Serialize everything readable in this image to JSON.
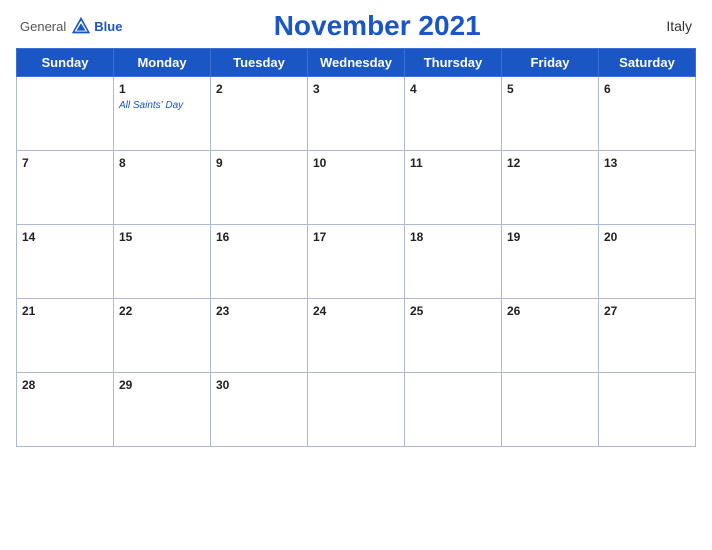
{
  "logo": {
    "general": "General",
    "blue": "Blue",
    "tagline": ""
  },
  "header": {
    "title": "November 2021",
    "country": "Italy"
  },
  "days_of_week": [
    "Sunday",
    "Monday",
    "Tuesday",
    "Wednesday",
    "Thursday",
    "Friday",
    "Saturday"
  ],
  "weeks": [
    [
      {
        "num": "",
        "empty": true
      },
      {
        "num": "1",
        "holiday": "All Saints' Day"
      },
      {
        "num": "2",
        "holiday": ""
      },
      {
        "num": "3",
        "holiday": ""
      },
      {
        "num": "4",
        "holiday": ""
      },
      {
        "num": "5",
        "holiday": ""
      },
      {
        "num": "6",
        "holiday": ""
      }
    ],
    [
      {
        "num": "7",
        "holiday": ""
      },
      {
        "num": "8",
        "holiday": ""
      },
      {
        "num": "9",
        "holiday": ""
      },
      {
        "num": "10",
        "holiday": ""
      },
      {
        "num": "11",
        "holiday": ""
      },
      {
        "num": "12",
        "holiday": ""
      },
      {
        "num": "13",
        "holiday": ""
      }
    ],
    [
      {
        "num": "14",
        "holiday": ""
      },
      {
        "num": "15",
        "holiday": ""
      },
      {
        "num": "16",
        "holiday": ""
      },
      {
        "num": "17",
        "holiday": ""
      },
      {
        "num": "18",
        "holiday": ""
      },
      {
        "num": "19",
        "holiday": ""
      },
      {
        "num": "20",
        "holiday": ""
      }
    ],
    [
      {
        "num": "21",
        "holiday": ""
      },
      {
        "num": "22",
        "holiday": ""
      },
      {
        "num": "23",
        "holiday": ""
      },
      {
        "num": "24",
        "holiday": ""
      },
      {
        "num": "25",
        "holiday": ""
      },
      {
        "num": "26",
        "holiday": ""
      },
      {
        "num": "27",
        "holiday": ""
      }
    ],
    [
      {
        "num": "28",
        "holiday": ""
      },
      {
        "num": "29",
        "holiday": ""
      },
      {
        "num": "30",
        "holiday": ""
      },
      {
        "num": "",
        "empty": true
      },
      {
        "num": "",
        "empty": true
      },
      {
        "num": "",
        "empty": true
      },
      {
        "num": "",
        "empty": true
      }
    ]
  ]
}
